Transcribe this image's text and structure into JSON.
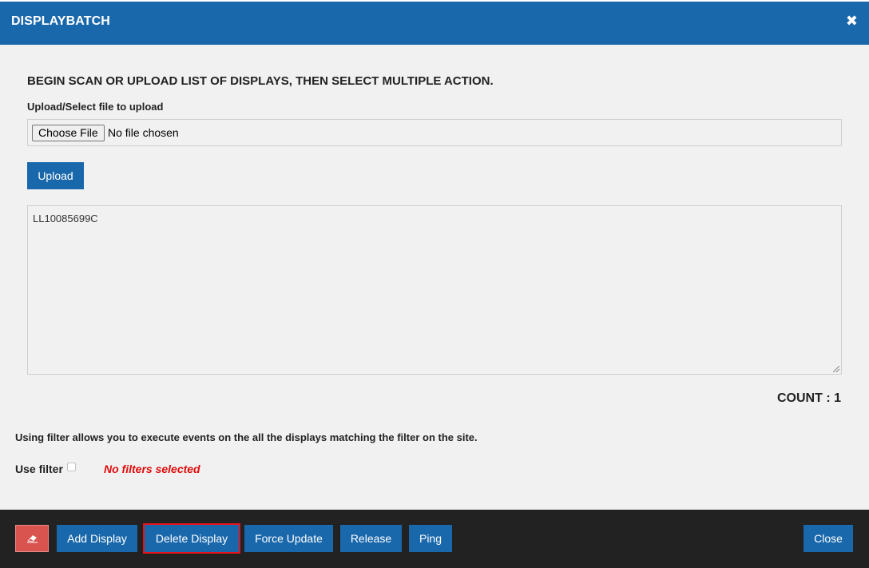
{
  "header": {
    "title": "DISPLAYBATCH",
    "close_glyph": "✖"
  },
  "main": {
    "instruction": "BEGIN SCAN OR UPLOAD LIST OF DISPLAYS, THEN SELECT MULTIPLE ACTION.",
    "upload_label": "Upload/Select file to upload",
    "file_input": {
      "button_label": "Choose File",
      "status": "No file chosen"
    },
    "upload_button": "Upload",
    "display_list": "LL10085699C",
    "count_label": "COUNT : 1",
    "filter_note": "Using filter allows you to execute events on the all the displays matching the filter on the site.",
    "use_filter_label": "Use filter",
    "no_filters": "No filters selected"
  },
  "footer": {
    "eraser_icon": "eraser-icon",
    "buttons": {
      "add": "Add Display",
      "delete": "Delete Display",
      "force": "Force Update",
      "release": "Release",
      "ping": "Ping",
      "close": "Close"
    }
  },
  "colors": {
    "header_bg": "#1a68ac",
    "button_blue": "#1a68ac",
    "footer_bg": "#222222",
    "eraser_red": "#d9534f",
    "highlight_red": "#e8141c",
    "warning_text": "#e20a0a"
  }
}
